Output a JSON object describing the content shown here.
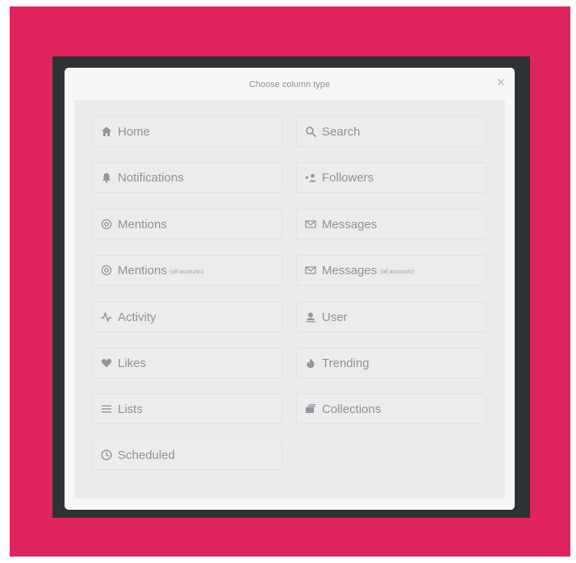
{
  "modal": {
    "title": "Choose column type",
    "close_glyph": "×"
  },
  "options": [
    {
      "id": "home",
      "label": "Home",
      "sub": "",
      "icon": "home-icon"
    },
    {
      "id": "search",
      "label": "Search",
      "sub": "",
      "icon": "search-icon"
    },
    {
      "id": "notifications",
      "label": "Notifications",
      "sub": "",
      "icon": "bell-icon"
    },
    {
      "id": "followers",
      "label": "Followers",
      "sub": "",
      "icon": "follow-user-icon"
    },
    {
      "id": "mentions",
      "label": "Mentions",
      "sub": "",
      "icon": "at-icon"
    },
    {
      "id": "messages",
      "label": "Messages",
      "sub": "",
      "icon": "envelope-icon"
    },
    {
      "id": "mentions-all",
      "label": "Mentions",
      "sub": "(all accounts)",
      "icon": "at-icon"
    },
    {
      "id": "messages-all",
      "label": "Messages",
      "sub": "(all accounts)",
      "icon": "envelope-icon"
    },
    {
      "id": "activity",
      "label": "Activity",
      "sub": "",
      "icon": "pulse-icon"
    },
    {
      "id": "user",
      "label": "User",
      "sub": "",
      "icon": "user-icon"
    },
    {
      "id": "likes",
      "label": "Likes",
      "sub": "",
      "icon": "heart-icon"
    },
    {
      "id": "trending",
      "label": "Trending",
      "sub": "",
      "icon": "flame-icon"
    },
    {
      "id": "lists",
      "label": "Lists",
      "sub": "",
      "icon": "list-icon"
    },
    {
      "id": "collections",
      "label": "Collections",
      "sub": "",
      "icon": "collection-icon"
    },
    {
      "id": "scheduled",
      "label": "Scheduled",
      "sub": "",
      "icon": "clock-icon"
    }
  ]
}
